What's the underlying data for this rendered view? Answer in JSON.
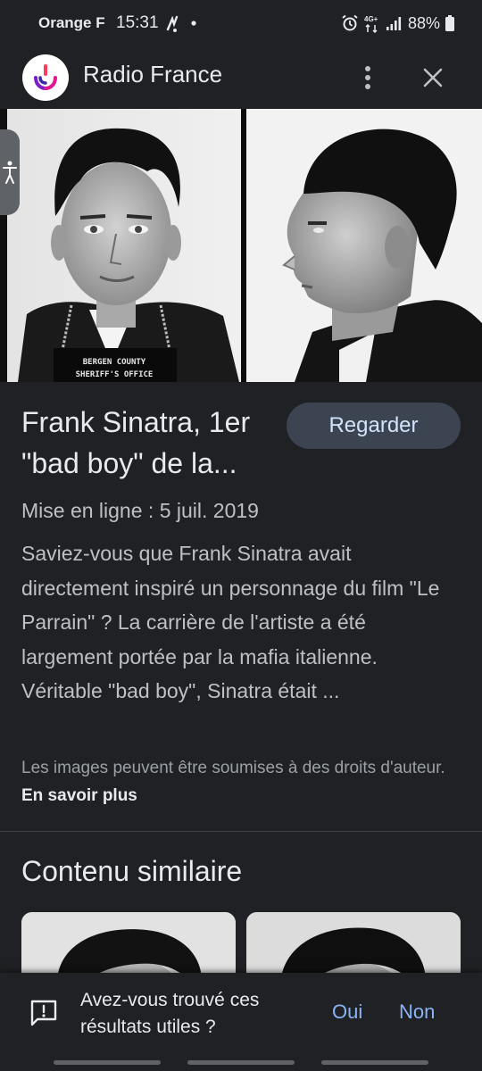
{
  "status_bar": {
    "carrier": "Orange F",
    "time": "15:31",
    "network": "4G+",
    "battery": "88%"
  },
  "header": {
    "title": "Radio France"
  },
  "result": {
    "title": "Frank Sinatra, 1er \"bad boy\" de la...",
    "watch_label": "Regarder",
    "date": "Mise en ligne : 5 juil. 2019",
    "description": "Saviez-vous que Frank Sinatra avait directement inspiré un personnage du film \"Le Parrain\" ? La carrière de l'artiste a été largement portée par la mafia italienne. Véritable \"bad boy\", Sinatra était ...",
    "copyright_text": "Les images peuvent être soumises à des droits d'auteur.",
    "learn_more": "En savoir plus",
    "image_sign": [
      "BERGEN COUNTY",
      "SHERIFF'S OFFICE"
    ]
  },
  "similar": {
    "heading": "Contenu similaire"
  },
  "feedback": {
    "question": "Avez-vous trouvé ces résultats utiles ?",
    "yes": "Oui",
    "no": "Non"
  },
  "colors": {
    "background": "#202124",
    "accent": "#8ab4f8",
    "button": "#3c4452"
  },
  "icons": [
    "radio-france-logo-icon",
    "more-vert-icon",
    "close-icon",
    "accessibility-icon",
    "feedback-icon",
    "alarm-icon",
    "signal-icon",
    "battery-icon"
  ]
}
